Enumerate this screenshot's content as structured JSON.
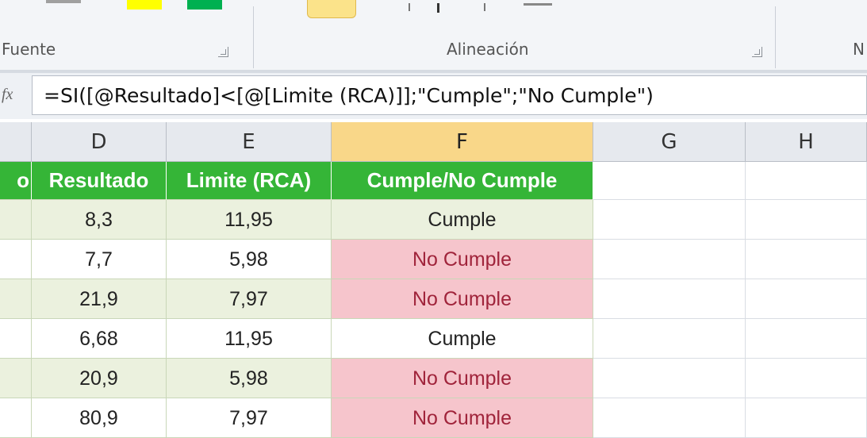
{
  "ribbon": {
    "groups": [
      {
        "label": "Fuente"
      },
      {
        "label": "Alineación"
      },
      {
        "label": "N"
      }
    ]
  },
  "formula_bar": {
    "fx_label": "fx",
    "formula": "=SI([@Resultado]<[@[Limite (RCA)]];\"Cumple\";\"No Cumple\")"
  },
  "columns": [
    "D",
    "E",
    "F",
    "G",
    "H"
  ],
  "selected_column": "F",
  "table": {
    "partial_header": "o",
    "headers": [
      "Resultado",
      "Limite (RCA)",
      "Cumple/No Cumple"
    ],
    "rows": [
      {
        "resultado": "8,3",
        "limite": "11,95",
        "estado": "Cumple"
      },
      {
        "resultado": "7,7",
        "limite": "5,98",
        "estado": "No Cumple"
      },
      {
        "resultado": "21,9",
        "limite": "7,97",
        "estado": "No Cumple"
      },
      {
        "resultado": "6,68",
        "limite": "11,95",
        "estado": "Cumple"
      },
      {
        "resultado": "20,9",
        "limite": "5,98",
        "estado": "No Cumple"
      },
      {
        "resultado": "80,9",
        "limite": "7,97",
        "estado": "No Cumple"
      }
    ]
  },
  "colors": {
    "header_green": "#35b537",
    "band_green": "#ebf1de",
    "bad_fill": "#f6c5cc",
    "bad_text": "#a0243b",
    "selected_header": "#f9d789"
  }
}
